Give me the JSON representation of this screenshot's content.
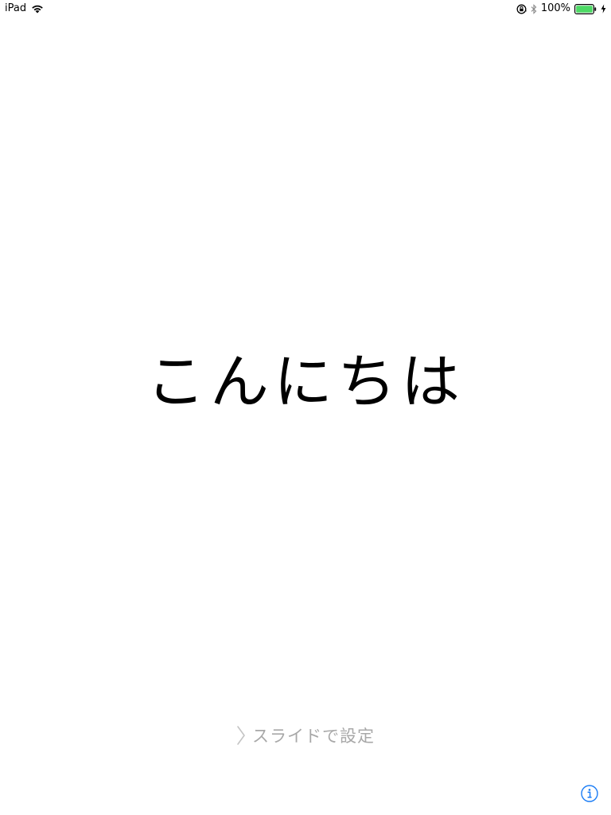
{
  "status_bar": {
    "device_name": "iPad",
    "battery_percent": "100%",
    "battery_level": 1.0,
    "icons": [
      "wifi-icon",
      "orientation-lock-icon",
      "bluetooth-icon",
      "battery-icon",
      "charging-icon"
    ],
    "battery_color": "#4cd964"
  },
  "greeting": {
    "text": "こんにちは"
  },
  "slide_setup": {
    "label": "スライドで設定",
    "icon": "chevron-right-icon"
  },
  "info_button": {
    "icon": "info-icon",
    "color": "#1a7cf5"
  }
}
